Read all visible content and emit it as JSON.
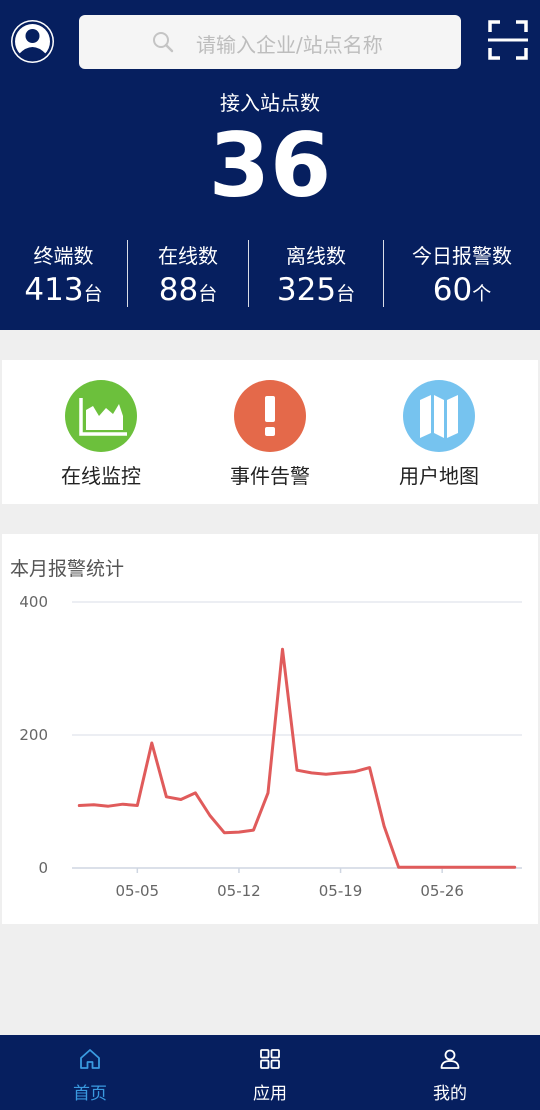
{
  "header": {
    "search_placeholder": "请输入企业/站点名称",
    "hero_label": "接入站点数",
    "hero_value": "36"
  },
  "stats": [
    {
      "label": "终端数",
      "value": "413",
      "unit": "台"
    },
    {
      "label": "在线数",
      "value": "88",
      "unit": "台"
    },
    {
      "label": "离线数",
      "value": "325",
      "unit": "台"
    },
    {
      "label": "今日报警数",
      "value": "60",
      "unit": "个"
    }
  ],
  "quick_actions": [
    {
      "label": "在线监控",
      "icon": "area-chart-icon",
      "color": "#6cc03c"
    },
    {
      "label": "事件告警",
      "icon": "exclamation-icon",
      "color": "#e4694a"
    },
    {
      "label": "用户地图",
      "icon": "map-icon",
      "color": "#76c3ef"
    }
  ],
  "chart_title": "本月报警统计",
  "chart_data": {
    "type": "line",
    "title": "本月报警统计",
    "x": [
      "05-01",
      "05-02",
      "05-03",
      "05-04",
      "05-05",
      "05-06",
      "05-07",
      "05-08",
      "05-09",
      "05-10",
      "05-11",
      "05-12",
      "05-13",
      "05-14",
      "05-15",
      "05-16",
      "05-17",
      "05-18",
      "05-19",
      "05-20",
      "05-21",
      "05-22",
      "05-23",
      "05-24",
      "05-25",
      "05-26",
      "05-27",
      "05-28",
      "05-29",
      "05-30",
      "05-31"
    ],
    "tick_labels": [
      "05-05",
      "05-12",
      "05-19",
      "05-26"
    ],
    "series": [
      {
        "values": [
          94,
          95,
          93,
          96,
          94,
          188,
          107,
          103,
          113,
          79,
          53,
          54,
          57,
          113,
          329,
          147,
          143,
          141,
          143,
          145,
          151,
          63,
          1,
          1,
          1,
          1,
          1,
          1,
          1,
          1,
          1
        ],
        "color": "#e05b5b"
      }
    ],
    "ylim": [
      0,
      400
    ],
    "y_ticks": [
      0,
      200,
      400
    ],
    "grid": true
  },
  "nav": [
    {
      "label": "首页",
      "icon": "home-icon",
      "active": true
    },
    {
      "label": "应用",
      "icon": "apps-grid-icon",
      "active": false
    },
    {
      "label": "我的",
      "icon": "user-icon",
      "active": false
    }
  ],
  "colors": {
    "primary": "#061f5f",
    "active_nav": "#3a9ae0",
    "line": "#e05b5b"
  }
}
